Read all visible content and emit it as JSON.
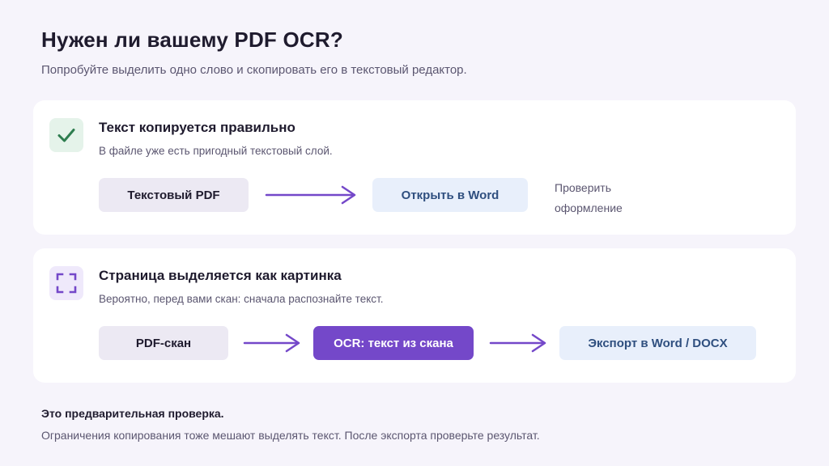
{
  "header": {
    "title": "Нужен ли вашему PDF OCR?",
    "subtitle": "Попробуйте выделить одно слово и скопировать его в текстовый редактор."
  },
  "cards": [
    {
      "icon": "checkmark-icon",
      "title": "Текст копируется правильно",
      "description": "В файле уже есть пригодный текстовый слой.",
      "steps": [
        "Текстовый PDF",
        "Открыть в Word"
      ],
      "note": "Проверить оформление"
    },
    {
      "icon": "scan-frame-icon",
      "title": "Страница выделяется как картинка",
      "description": "Вероятно, перед вами скан: сначала распознайте текст.",
      "steps": [
        "PDF-скан",
        "OCR: текст из скана",
        "Экспорт в Word / DOCX"
      ]
    }
  ],
  "footer": {
    "title": "Это предварительная проверка.",
    "text": "Ограничения копирования тоже мешают выделять текст. После экспорта проверьте результат."
  },
  "colors": {
    "accent_purple": "#7448c9",
    "check_green": "#2e7d4f",
    "blue_text": "#2f4f7f",
    "background": "#f6f4fb"
  }
}
